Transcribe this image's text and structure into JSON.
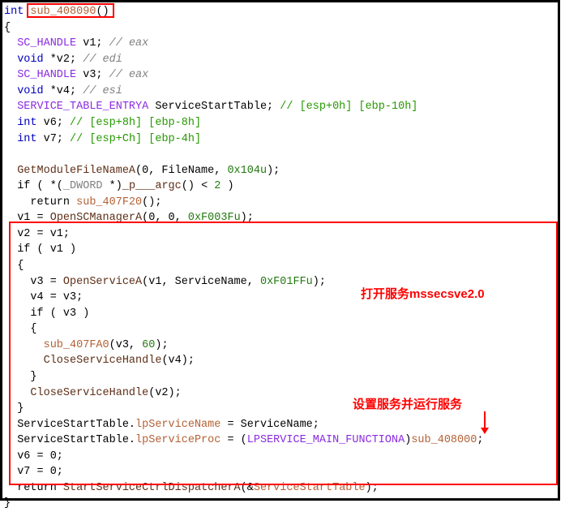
{
  "code": {
    "l1_int": "int",
    "l1_fn": "sub_408090",
    "l1_paren": "()",
    "l2": "{",
    "l3_ty": "SC_HANDLE",
    "l3_var": " v1; ",
    "l3_cmt": "// eax",
    "l4_ty": "void",
    "l4_var": " *v2; ",
    "l4_cmt": "// edi",
    "l5_ty": "SC_HANDLE",
    "l5_var": " v3; ",
    "l5_cmt": "// eax",
    "l6_ty": "void",
    "l6_var": " *v4; ",
    "l6_cmt": "// esi",
    "l7_ty": "SERVICE_TABLE_ENTRYA",
    "l7_nm": " ServiceStartTable; ",
    "l7_cmt": "// [esp+0h] [ebp-10h]",
    "l8_ty": "int",
    "l8_var": " v6; ",
    "l8_cmt": "// [esp+8h] [ebp-8h]",
    "l9_ty": "int",
    "l9_var": " v7; ",
    "l9_cmt": "// [esp+Ch] [ebp-4h]",
    "l11_fn": "GetModuleFileNameA",
    "l11_args": "(0, FileName, ",
    "l11_num": "0x104u",
    "l11_end": ");",
    "l12_a": "  if ( *(",
    "l12_mac": "_DWORD",
    "l12_b": " *)",
    "l12_fn": "_p___argc",
    "l12_c": "() < ",
    "l12_num": "2",
    "l12_d": " )",
    "l13_a": "    return ",
    "l13_fn": "sub_407F20",
    "l13_b": "();",
    "l14_a": "  v1 = ",
    "l14_fn": "OpenSCManagerA",
    "l14_b": "(0, 0, ",
    "l14_num": "0xF003Fu",
    "l14_c": ");",
    "l15": "  v2 = v1;",
    "l16": "  if ( v1 )",
    "l17": "  {",
    "l18_a": "    v3 = ",
    "l18_fn": "OpenServiceA",
    "l18_b": "(v1, ServiceName, ",
    "l18_num": "0xF01FFu",
    "l18_c": ");",
    "l19": "    v4 = v3;",
    "l20": "    if ( v3 )",
    "l21": "    {",
    "l22_a": "      ",
    "l22_fn": "sub_407FA0",
    "l22_b": "(v3, ",
    "l22_num": "60",
    "l22_c": ");",
    "l23_a": "      ",
    "l23_fn": "CloseServiceHandle",
    "l23_b": "(v4);",
    "l24": "    }",
    "l25_a": "    ",
    "l25_fn": "CloseServiceHandle",
    "l25_b": "(v2);",
    "l26": "  }",
    "l27_a": "  ServiceStartTable.",
    "l27_f": "lpServiceName",
    "l27_b": " = ServiceName;",
    "l28_a": "  ServiceStartTable.",
    "l28_f": "lpServiceProc",
    "l28_b": " = (",
    "l28_ty": "LPSERVICE_MAIN_FUNCTIONA",
    "l28_c": ")",
    "l28_fn": "sub_408000",
    "l28_d": ";",
    "l29": "  v6 = 0;",
    "l30": "  v7 = 0;",
    "l31_a": "  return ",
    "l31_fn": "StartServiceCtrlDispatcherA",
    "l31_b": "(&",
    "l31_var": "ServiceStartTable",
    "l31_c": ");",
    "l32": "}"
  },
  "annotations": {
    "open_service": "打开服务mssecsve2.0",
    "set_run_service": "设置服务并运行服务"
  },
  "highlights": {
    "top_box": {
      "desc": "red box around sub_408090()"
    },
    "main_box": {
      "desc": "red box around service manager block"
    }
  }
}
